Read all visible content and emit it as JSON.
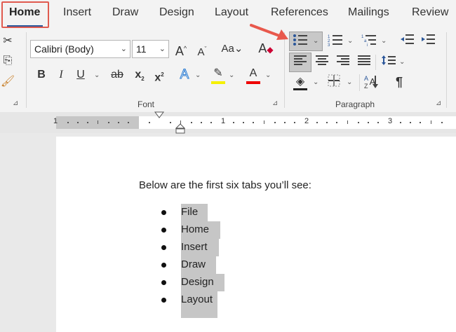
{
  "tabs": [
    "Home",
    "Insert",
    "Draw",
    "Design",
    "Layout",
    "References",
    "Mailings",
    "Review"
  ],
  "font": {
    "name": "Calibri (Body)",
    "size": "11"
  },
  "groups": {
    "font": "Font",
    "paragraph": "Paragraph"
  },
  "ruler": {
    "numbers": [
      "1",
      "1",
      "2",
      "3"
    ]
  },
  "document": {
    "intro": "Below are the first six tabs you’ll see:",
    "items": [
      "File",
      "Home",
      "Insert",
      "Draw",
      "Design",
      "Layout"
    ]
  },
  "colors": {
    "accent": "#2b579a",
    "highlight_box": "#e05a4f",
    "arrow": "#e8584c",
    "selection": "#c6c6c6"
  },
  "icons": [
    "scissors-icon",
    "copy-icon",
    "format-painter-icon",
    "bullets-icon",
    "numbering-icon",
    "multilevel-list-icon",
    "show-formatting-icon"
  ]
}
